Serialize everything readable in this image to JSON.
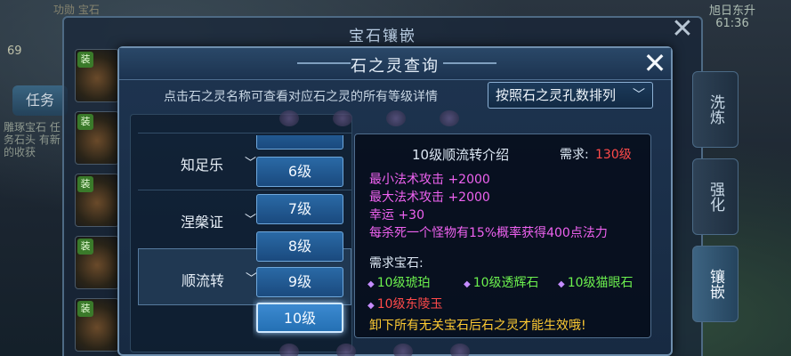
{
  "background": {
    "top_left_text": "功勋  宝石",
    "top_right_text": "旭日东升",
    "top_right_time": "61:36",
    "level": "69",
    "task_button": "任务",
    "task_text": "雕琢宝石 任务石头 有新的收获"
  },
  "outer_window": {
    "title": "宝石镶嵌",
    "tabs": [
      "洗炼",
      "强化",
      "镶嵌"
    ],
    "active_tab": "镶嵌",
    "item_tag": "装"
  },
  "dialog": {
    "title": "石之灵查询",
    "hint": "点击石之灵名称可查看对应石之灵的所有等级详情",
    "sort_option": "按照石之灵孔数排列",
    "gem_list": [
      {
        "name": "知足乐"
      },
      {
        "name": "涅槃证"
      },
      {
        "name": "顺流转"
      }
    ],
    "levels": [
      "6级",
      "7级",
      "8级",
      "9级",
      "10级"
    ],
    "selected_level": "10级",
    "detail": {
      "title": "10级顺流转介绍",
      "req_label": "需求:",
      "req_value": "130级",
      "stats": [
        "最小法术攻击 +2000",
        "最大法术攻击 +2000",
        "幸运 +30",
        "每杀死一个怪物有15%概率获得400点法力"
      ],
      "need_label": "需求宝石:",
      "gems": [
        "10级琥珀",
        "10级透辉石",
        "10级猫眼石",
        "10级东陵玉"
      ],
      "warning": "卸下所有无关宝石后石之灵才能生效哦!"
    }
  },
  "colors": {
    "stat": "#ee62f0",
    "gem_ok": "#6cf04e",
    "gem_missing": "#ff4a4a",
    "warning": "#ffcb33"
  }
}
